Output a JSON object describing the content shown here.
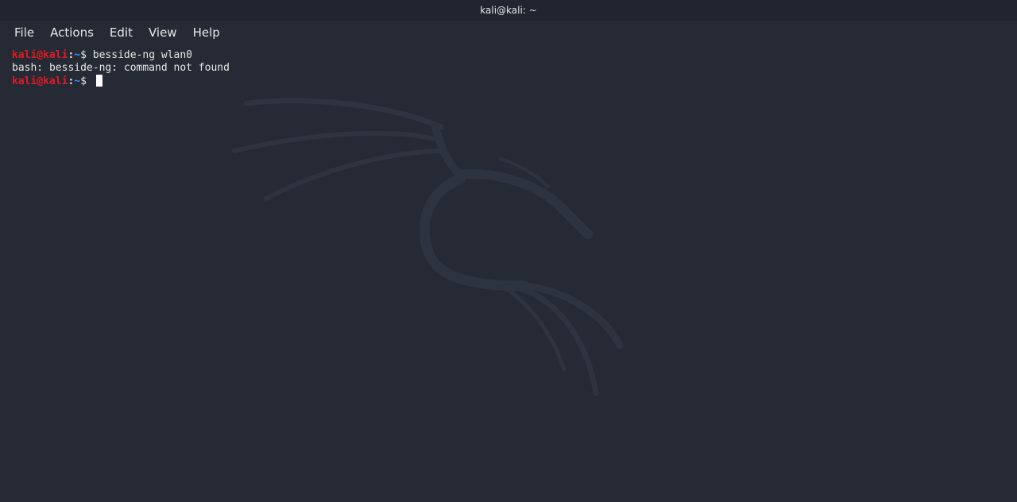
{
  "window": {
    "title": "kali@kali: ~"
  },
  "menu": {
    "items": [
      "File",
      "Actions",
      "Edit",
      "View",
      "Help"
    ]
  },
  "terminal": {
    "lines": [
      {
        "user": "kali@kali",
        "sep": ":",
        "path": "~",
        "dollar": "$",
        "command": " besside-ng wlan0"
      },
      {
        "output": "bash: besside-ng: command not found"
      },
      {
        "user": "kali@kali",
        "sep": ":",
        "path": "~",
        "dollar": "$",
        "command": " "
      }
    ]
  },
  "colors": {
    "background": "#252a35",
    "prompt_user": "#e01b24",
    "prompt_path": "#3d8bff",
    "text": "#e6e6e6"
  },
  "icons": {
    "background_logo": "kali-dragon-icon"
  }
}
